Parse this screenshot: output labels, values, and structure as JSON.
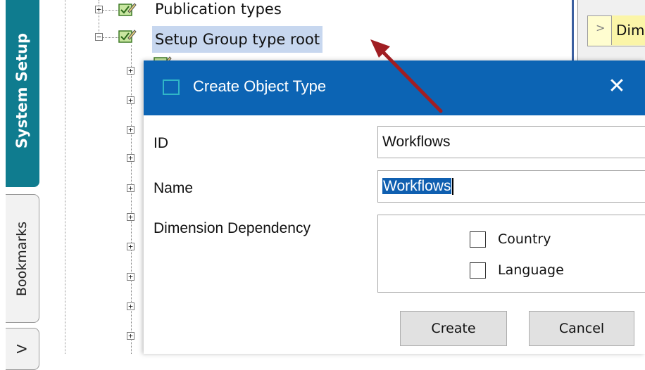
{
  "sidebar": {
    "tabs": [
      {
        "label": "System Setup",
        "active": true
      },
      {
        "label": "Bookmarks",
        "active": false
      },
      {
        "label": "V",
        "active": false
      }
    ]
  },
  "tree": {
    "nodes": [
      {
        "label": "Publication types",
        "expanded": false
      },
      {
        "label": "Setup Group type root",
        "expanded": true,
        "selected": true
      }
    ]
  },
  "right_panel": {
    "cell_text": "Dim",
    "chevron": ">"
  },
  "dialog": {
    "title": "Create Object Type",
    "close_glyph": "✕",
    "fields": {
      "id": {
        "label": "ID",
        "value": "Workflows"
      },
      "name": {
        "label": "Name",
        "value": "Workflows"
      }
    },
    "dimension_dependency": {
      "label": "Dimension Dependency",
      "options": [
        {
          "label": "Country",
          "checked": false
        },
        {
          "label": "Language",
          "checked": false
        }
      ]
    },
    "buttons": {
      "create": "Create",
      "cancel": "Cancel"
    }
  },
  "colors": {
    "titlebar": "#0c64b4",
    "active_tab": "#0f7c8f",
    "selection": "#c7d7ef",
    "annotation_arrow": "#a01e23"
  }
}
